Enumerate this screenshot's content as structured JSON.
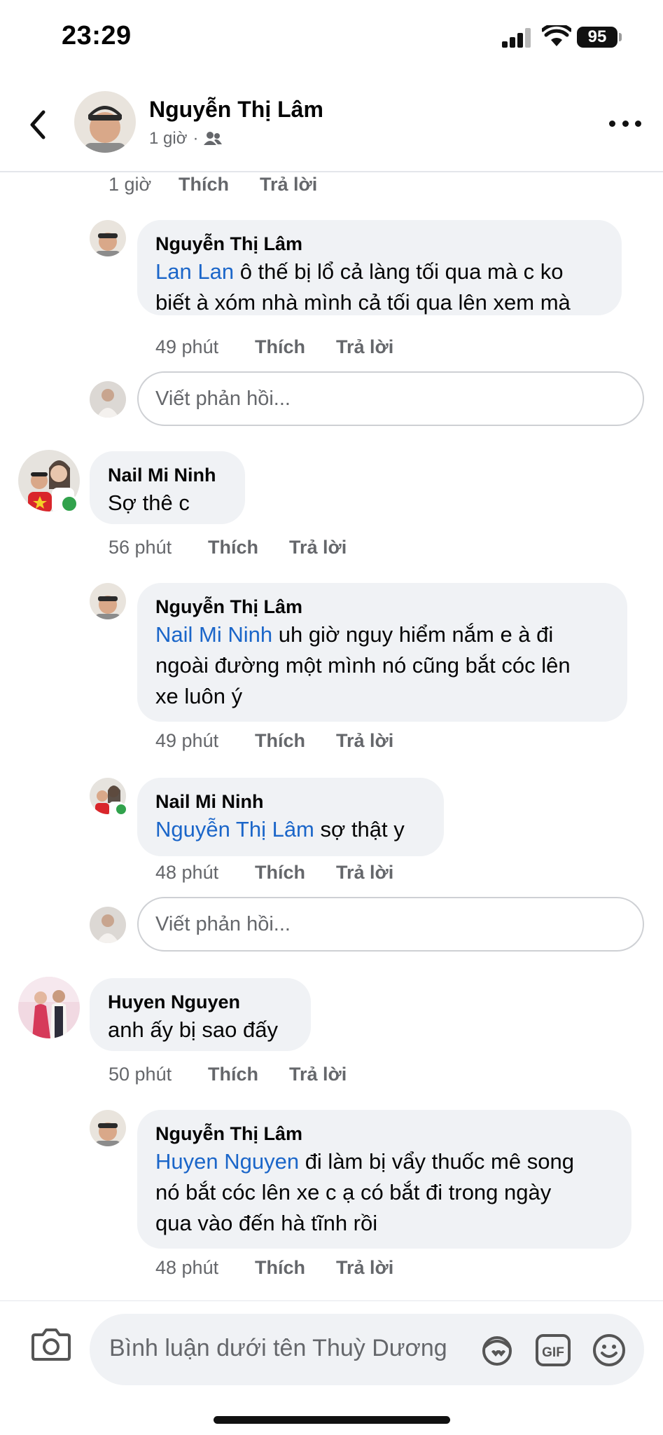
{
  "status_bar": {
    "time": "23:29",
    "battery": "95"
  },
  "header": {
    "name": "Nguyễn Thị Lâm",
    "meta_time": "1 giờ",
    "meta_sep": "·"
  },
  "top_actions": {
    "time": "1 giờ",
    "like": "Thích",
    "reply": "Trả lời"
  },
  "threads": [
    {
      "replies": [
        {
          "author": "Nguyễn Thị Lâm",
          "mention": "Lan Lan",
          "lines": [
            "ô thế bị  lổ cả làng tối qua mà c ko",
            "biết à xóm nhà mình cả tối qua lên xem mà"
          ],
          "time": "49 phút",
          "like": "Thích",
          "reply": "Trả lời"
        }
      ],
      "reply_placeholder": "Viết phản hồi..."
    },
    {
      "comment": {
        "author": "Nail Mi Ninh",
        "text": "Sợ thê c",
        "time": "56 phút",
        "like": "Thích",
        "reply": "Trả lời"
      },
      "replies": [
        {
          "author": "Nguyễn Thị Lâm",
          "mention": "Nail Mi Ninh",
          "lines": [
            " uh giờ nguy hiểm nắm e à đi",
            "ngoài đường một mình nó cũng bắt cóc lên",
            "xe luôn ý"
          ],
          "time": "49 phút",
          "like": "Thích",
          "reply": "Trả lời"
        },
        {
          "author": "Nail Mi Ninh",
          "mention": "Nguyễn Thị Lâm",
          "lines": [
            " sợ thật y"
          ],
          "time": "48 phút",
          "like": "Thích",
          "reply": "Trả lời"
        }
      ],
      "reply_placeholder": "Viết phản hồi..."
    },
    {
      "comment": {
        "author": "Huyen Nguyen",
        "text": "anh ấy bị sao đấy",
        "time": "50 phút",
        "like": "Thích",
        "reply": "Trả lời"
      },
      "replies": [
        {
          "author": "Nguyễn Thị Lâm",
          "mention": "Huyen Nguyen",
          "lines": [
            " đi làm bị vẩy thuốc mê song",
            "nó bắt cóc lên xe c ạ có bắt đi trong ngày",
            "qua vào đến hà tĩnh rồi"
          ],
          "time": "48 phút",
          "like": "Thích",
          "reply": "Trả lời"
        }
      ]
    }
  ],
  "composer": {
    "placeholder": "Bình luận dưới tên Thuỳ Dương"
  },
  "icons": [
    "back-icon",
    "group-icon",
    "more-icon",
    "camera-icon",
    "avatar-sticker-icon",
    "gif-icon",
    "emoji-icon"
  ],
  "colors": {
    "mention": "#1b66c9",
    "bubble": "#f0f2f5",
    "muted": "#65676b",
    "online": "#31a24c"
  }
}
